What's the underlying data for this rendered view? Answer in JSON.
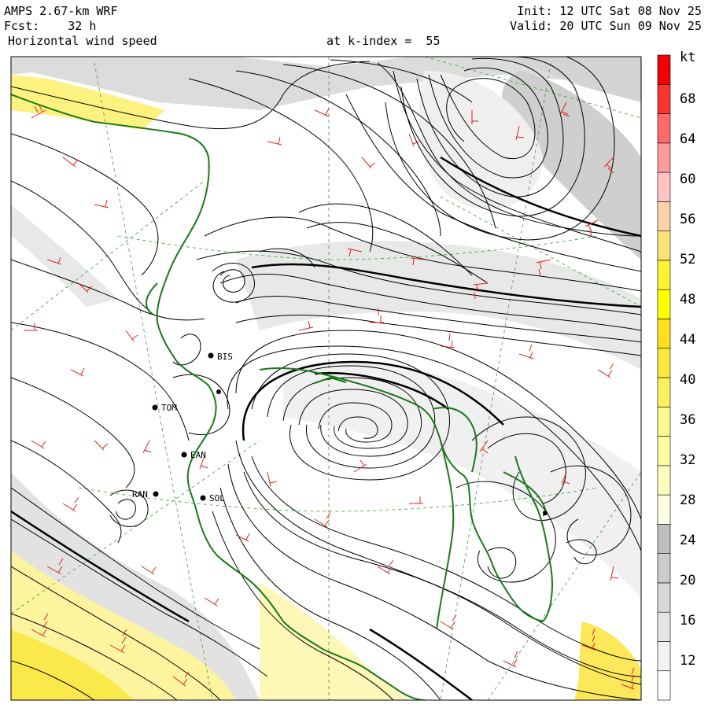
{
  "header": {
    "model": "AMPS 2.67-km WRF",
    "forecast": "Fcst:    32 h",
    "field": "Horizontal wind speed",
    "level": "at k-index =  55",
    "init": "Init: 12 UTC Sat 08 Nov 25",
    "valid": "Valid: 20 UTC Sun 09 Nov 25"
  },
  "stations": [
    {
      "name": "BIS"
    },
    {
      "name": "TOM"
    },
    {
      "name": "EAN"
    },
    {
      "name": "RAN"
    },
    {
      "name": "SOL"
    }
  ],
  "colorbar": {
    "unit": "kt",
    "ticks": [
      "68",
      "64",
      "60",
      "56",
      "52",
      "48",
      "44",
      "40",
      "36",
      "32",
      "28",
      "24",
      "20",
      "16",
      "12"
    ],
    "colors": [
      "#ffffff",
      "#f2f2f2",
      "#e6e6e6",
      "#d9d9d9",
      "#cccccc",
      "#bfbfbf",
      "#fefee0",
      "#fdfdc0",
      "#fdfda0",
      "#fbf890",
      "#fdf060",
      "#fde840",
      "#fde020",
      "#ffff00",
      "#fff230",
      "#fde27a",
      "#fed2a8",
      "#ffc3c3",
      "#fe9b9b",
      "#fe6a6a",
      "#fb3232",
      "#ef0000"
    ]
  },
  "colors": {
    "coast": "#1a7a1a",
    "barbs": "#dd2222",
    "grid": "#3c9a3c",
    "streamline": "#000000"
  }
}
